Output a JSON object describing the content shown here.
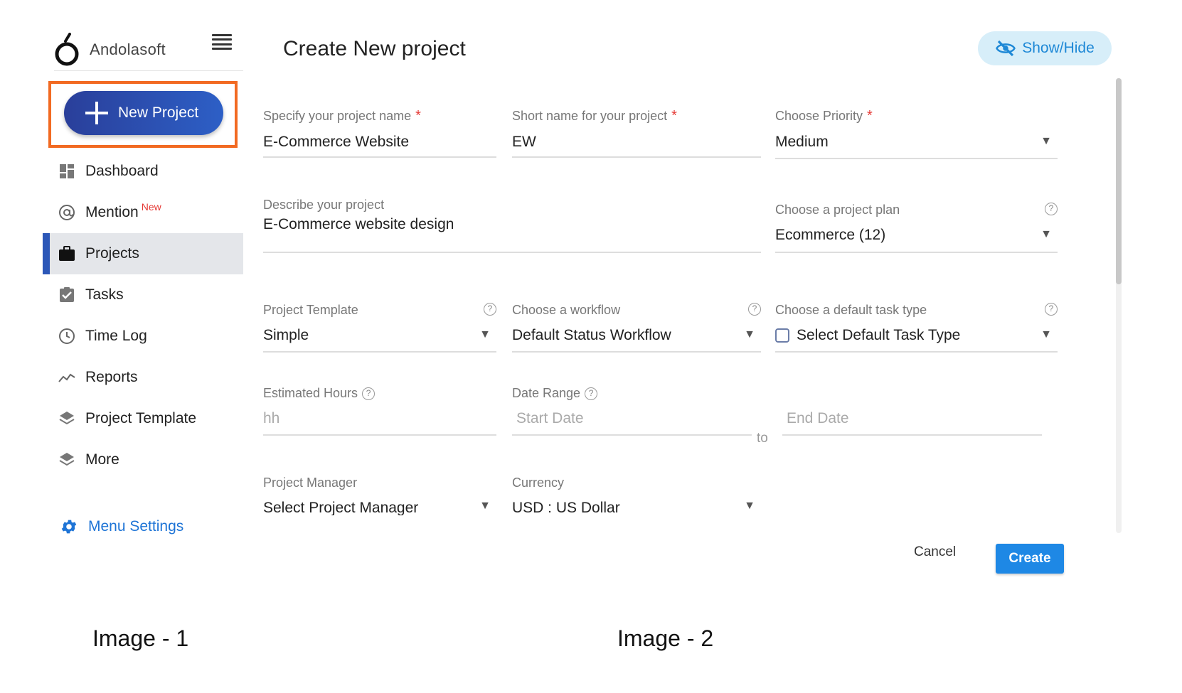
{
  "sidebar": {
    "brand_name": "Andolasoft",
    "new_project_label": "New Project",
    "items": [
      {
        "label": "Dashboard",
        "icon": "dashboard-icon"
      },
      {
        "label": "Mention",
        "icon": "at-icon",
        "badge": "New"
      },
      {
        "label": "Projects",
        "icon": "briefcase-icon",
        "active": true
      },
      {
        "label": "Tasks",
        "icon": "checklist-icon"
      },
      {
        "label": "Time Log",
        "icon": "clock-icon"
      },
      {
        "label": "Reports",
        "icon": "trend-icon"
      },
      {
        "label": "Project Template",
        "icon": "layers-icon"
      },
      {
        "label": "More",
        "icon": "layers-icon"
      }
    ],
    "menu_settings_label": "Menu Settings"
  },
  "form": {
    "title": "Create New project",
    "showhide_label": "Show/Hide",
    "project_name": {
      "label": "Specify your project name",
      "value": "E-Commerce Website"
    },
    "short_name": {
      "label": "Short name for your project",
      "value": "EW"
    },
    "priority": {
      "label": "Choose Priority",
      "value": "Medium"
    },
    "description": {
      "label": "Describe your project",
      "value": "E-Commerce website design"
    },
    "project_plan": {
      "label": "Choose a project plan",
      "value": "Ecommerce (12)"
    },
    "template": {
      "label": "Project Template",
      "value": "Simple"
    },
    "workflow": {
      "label": "Choose a workflow",
      "value": "Default Status Workflow"
    },
    "task_type": {
      "label": "Choose a default task type",
      "value": "Select Default Task Type"
    },
    "estimated_hours": {
      "label": "Estimated Hours",
      "placeholder": "hh"
    },
    "date_range": {
      "label": "Date Range",
      "start_placeholder": "Start Date",
      "to_label": "to",
      "end_placeholder": "End Date"
    },
    "project_manager": {
      "label": "Project Manager",
      "value": "Select Project Manager"
    },
    "currency": {
      "label": "Currency",
      "value": "USD : US Dollar"
    },
    "cancel_label": "Cancel",
    "create_label": "Create"
  },
  "captions": {
    "image1": "Image - 1",
    "image2": "Image - 2"
  },
  "colors": {
    "accent": "#1e88e5",
    "highlight": "#f26a22",
    "brand_blue": "#2c57b8",
    "required": "#e53935"
  }
}
